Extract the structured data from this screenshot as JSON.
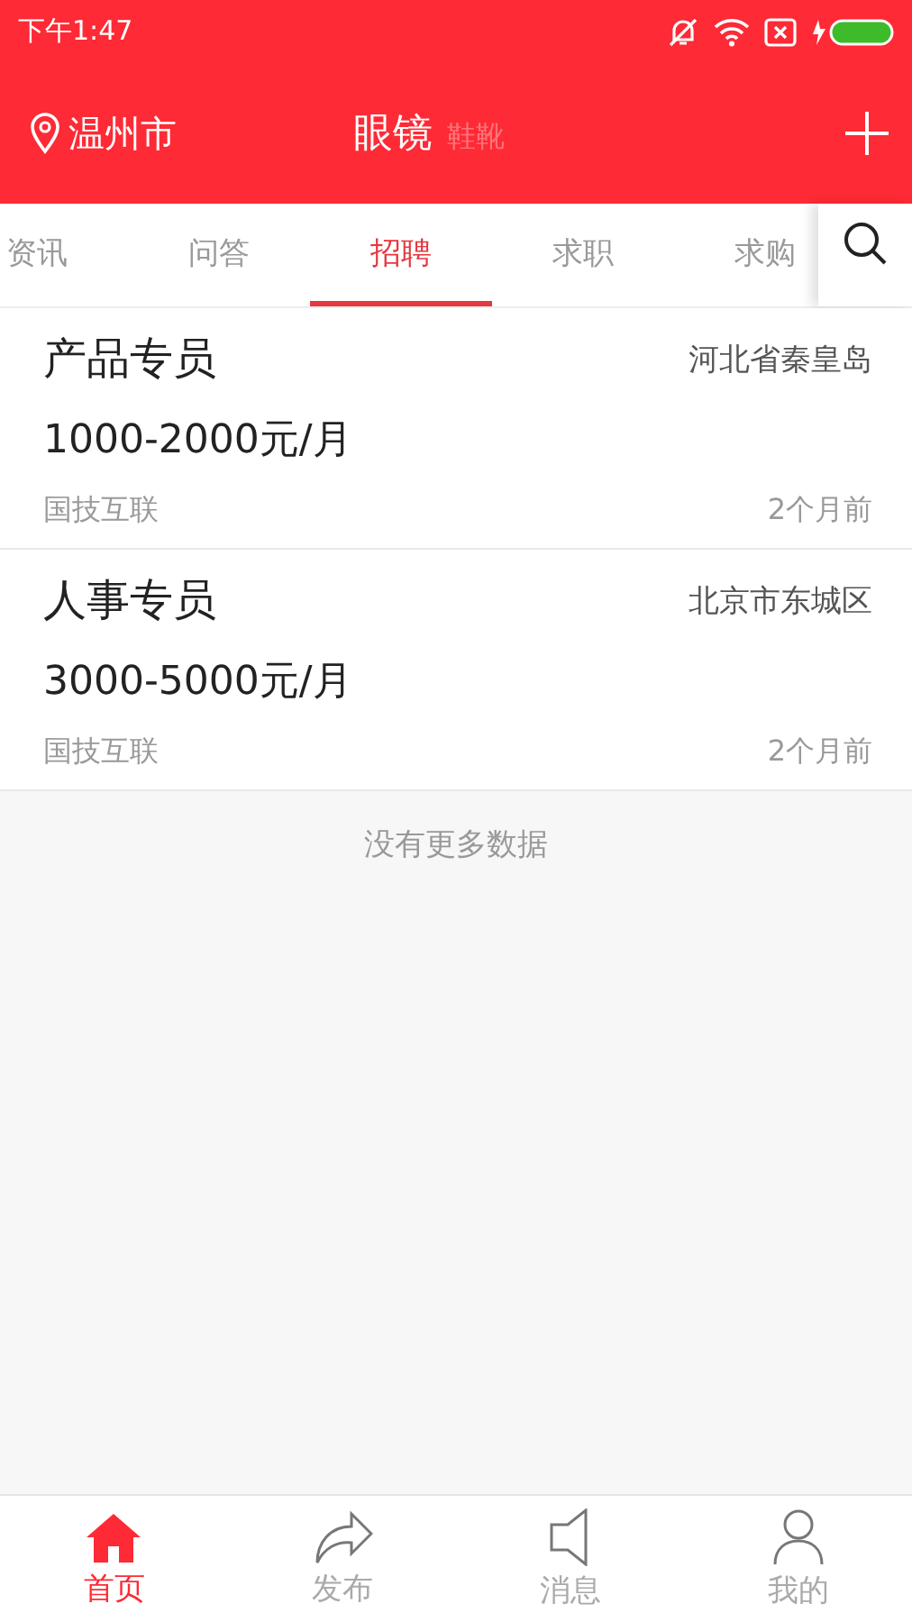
{
  "status_bar": {
    "time": "下午1:47"
  },
  "header": {
    "location": "温州市",
    "categories": [
      {
        "label": "眼镜",
        "selected": true
      },
      {
        "label": "鞋靴",
        "selected": false
      }
    ]
  },
  "tabs": [
    {
      "label": "资讯",
      "selected": false
    },
    {
      "label": "问答",
      "selected": false
    },
    {
      "label": "招聘",
      "selected": true
    },
    {
      "label": "求职",
      "selected": false
    },
    {
      "label": "求购",
      "selected": false
    }
  ],
  "jobs": [
    {
      "title": "产品专员",
      "location": "河北省秦皇岛",
      "salary": "1000-2000元/月",
      "company": "国技互联",
      "time": "2个月前"
    },
    {
      "title": "人事专员",
      "location": "北京市东城区",
      "salary": "3000-5000元/月",
      "company": "国技互联",
      "time": "2个月前"
    }
  ],
  "end_note": "没有更多数据",
  "bottom_nav": [
    {
      "label": "首页",
      "selected": true
    },
    {
      "label": "发布",
      "selected": false
    },
    {
      "label": "消息",
      "selected": false
    },
    {
      "label": "我的",
      "selected": false
    }
  ]
}
